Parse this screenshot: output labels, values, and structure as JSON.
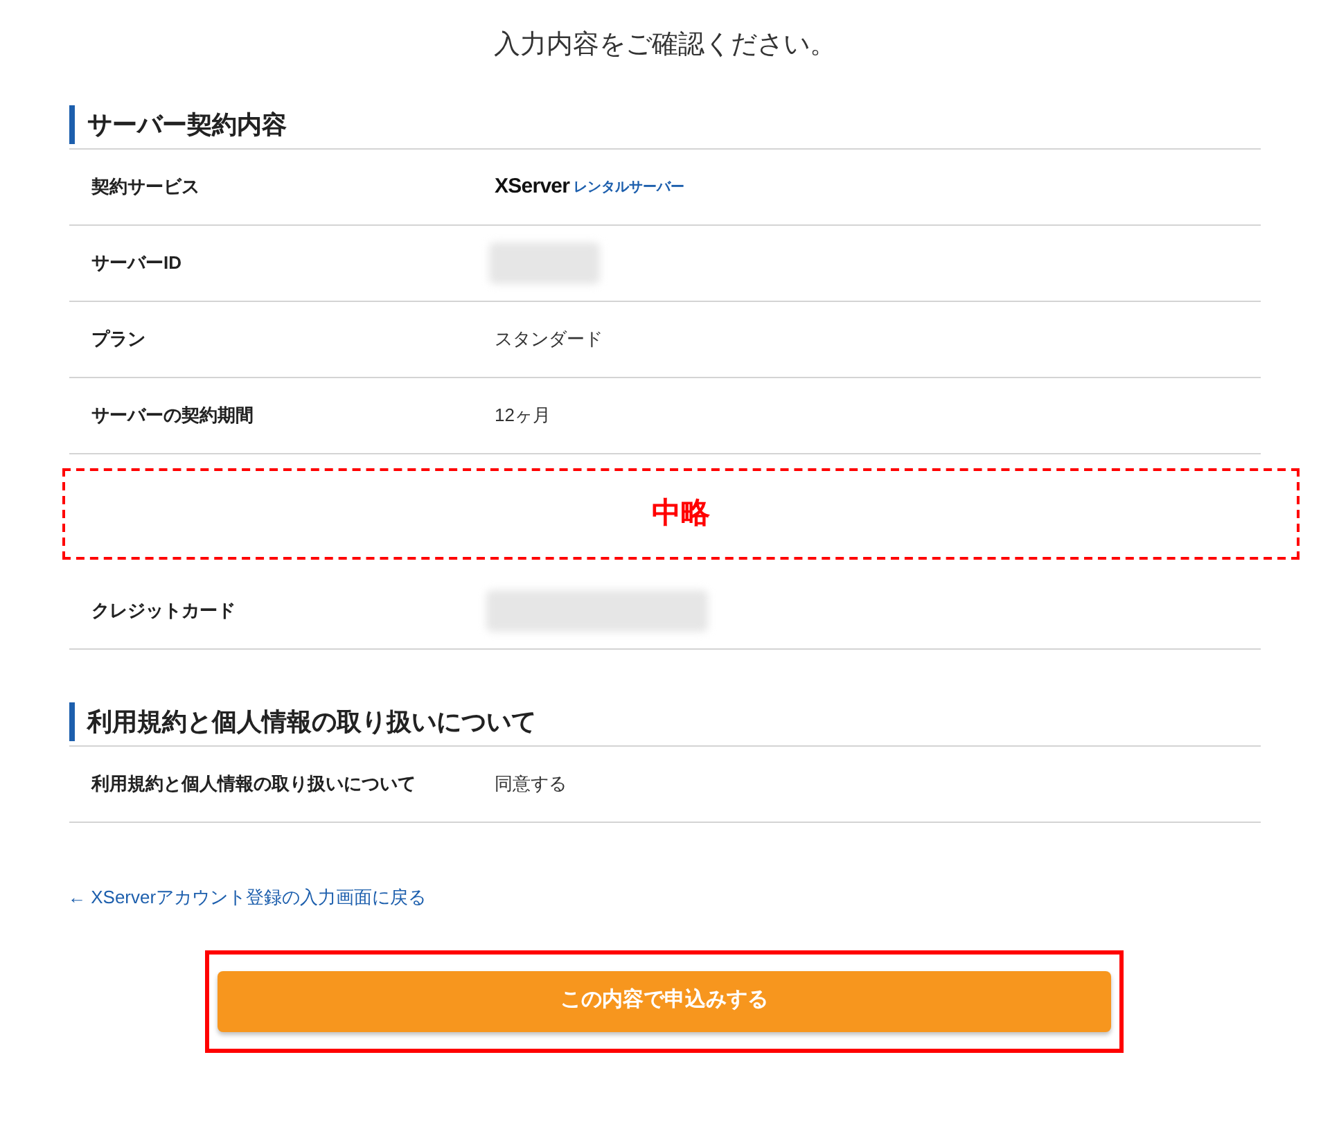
{
  "page_title": "入力内容をご確認ください。",
  "sections": [
    {
      "heading": "サーバー契約内容",
      "rows": [
        {
          "kind": "logo",
          "label": "契約サービス",
          "logo_text": "XServer",
          "logo_subtext": "レンタルサーバー"
        },
        {
          "kind": "blurred",
          "label": "サーバーID"
        },
        {
          "kind": "text",
          "label": "プラン",
          "value": "スタンダード"
        },
        {
          "kind": "text",
          "label": "サーバーの契約期間",
          "value": "12ヶ月"
        },
        {
          "kind": "omission",
          "label": "中略"
        },
        {
          "kind": "blurred",
          "label": "クレジットカード"
        }
      ]
    },
    {
      "heading": "利用規約と個人情報の取り扱いについて",
      "rows": [
        {
          "kind": "text",
          "label": "利用規約と個人情報の取り扱いについて",
          "value": "同意する"
        }
      ]
    }
  ],
  "back_link": "← XServerアカウント登録の入力画面に戻る",
  "submit_button": "この内容で申込みする"
}
